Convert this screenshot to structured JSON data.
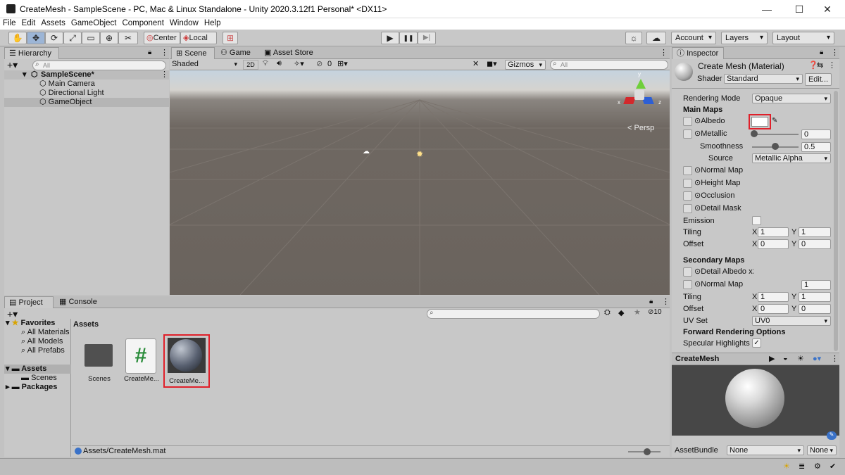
{
  "window": {
    "title": "CreateMesh - SampleScene - PC, Mac & Linux Standalone - Unity 2020.3.12f1 Personal* <DX11>",
    "minimize": "—",
    "maximize": "☐",
    "close": "✕"
  },
  "menu": [
    "File",
    "Edit",
    "Assets",
    "GameObject",
    "Component",
    "Window",
    "Help"
  ],
  "toolbar": {
    "center": "Center",
    "local": "Local",
    "account": "Account",
    "layers": "Layers",
    "layout": "Layout",
    "play": "▶",
    "pause": "❚❚",
    "step": "▶|"
  },
  "hierarchy": {
    "tab": "Hierarchy",
    "search_placeholder": "All",
    "scene": "SampleScene*",
    "items": [
      "Main Camera",
      "Directional Light",
      "GameObject"
    ]
  },
  "scene": {
    "tabs": [
      "Scene",
      "Game",
      "Asset Store"
    ],
    "shading": "Shaded",
    "mode2d": "2D",
    "hidden_count": "0",
    "gizmos": "Gizmos",
    "search_placeholder": "All",
    "persp": "Persp",
    "axes": {
      "x": "x",
      "y": "y",
      "z": "z"
    }
  },
  "project": {
    "tabs": [
      "Project",
      "Console"
    ],
    "favorites_label": "Favorites",
    "favorites": [
      "All Materials",
      "All Models",
      "All Prefabs"
    ],
    "assets_label": "Assets",
    "assets_children": [
      "Scenes"
    ],
    "packages_label": "Packages",
    "breadcrumb": "Assets",
    "count": "10",
    "items": [
      "Scenes",
      "CreateMe...",
      "CreateMe..."
    ],
    "path": "Assets/CreateMesh.mat"
  },
  "inspector": {
    "tab": "Inspector",
    "name": "Create Mesh (Material)",
    "shader_label": "Shader",
    "shader_value": "Standard",
    "edit_button": "Edit...",
    "rendering_mode_label": "Rendering Mode",
    "rendering_mode": "Opaque",
    "main_maps": "Main Maps",
    "albedo": "Albedo",
    "metallic": "Metallic",
    "metallic_value": "0",
    "smoothness": "Smoothness",
    "smoothness_value": "0.5",
    "smoothness_level": 0.5,
    "source_label": "Source",
    "source_value": "Metallic Alpha",
    "normal_map": "Normal Map",
    "height_map": "Height Map",
    "occlusion": "Occlusion",
    "detail_mask": "Detail Mask",
    "emission": "Emission",
    "tiling": "Tiling",
    "offset": "Offset",
    "x": "X",
    "y": "Y",
    "tiling_x": "1",
    "tiling_y": "1",
    "offset_x": "0",
    "offset_y": "0",
    "secondary_maps": "Secondary Maps",
    "detail_albedo": "Detail Albedo x2",
    "sec_normal_map": "Normal Map",
    "sec_normal_value": "1",
    "sec_tiling_x": "1",
    "sec_tiling_y": "1",
    "sec_offset_x": "0",
    "sec_offset_y": "0",
    "uv_set_label": "UV Set",
    "uv_set_value": "UV0",
    "forward_options": "Forward Rendering Options",
    "specular": "Specular Highlights",
    "preview_title": "CreateMesh",
    "assetbundle_label": "AssetBundle",
    "assetbundle_value": "None",
    "assetbundle_variant": "None"
  },
  "colors": {
    "highlight": "#e0202a",
    "scene_ground": "#6b625c",
    "scene_sky": "#b8c8d6",
    "accent": "#3a72c8"
  }
}
